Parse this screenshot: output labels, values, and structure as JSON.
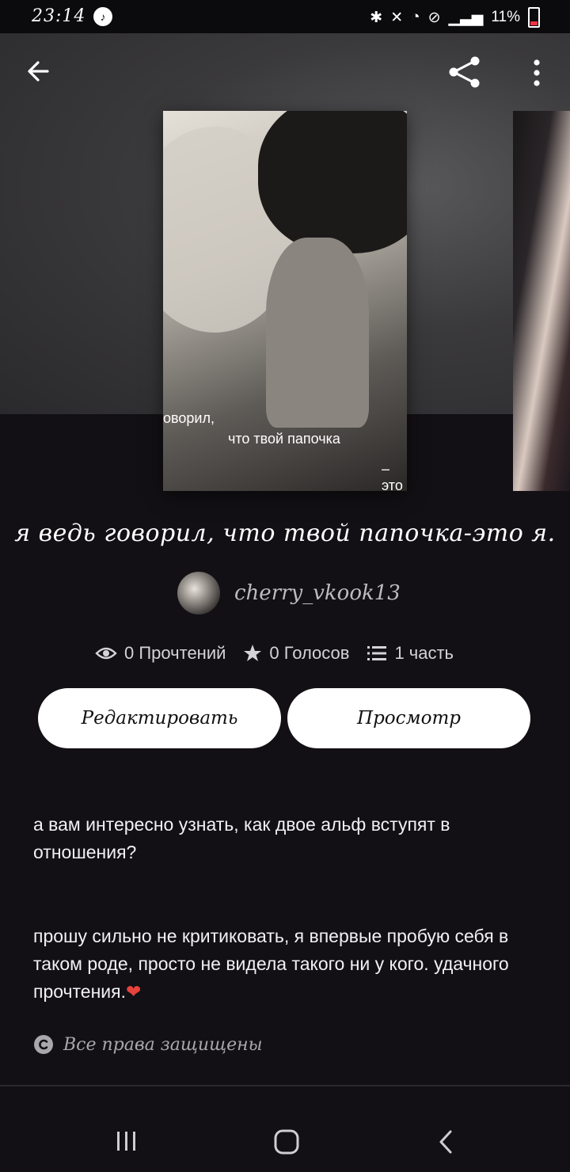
{
  "status_bar": {
    "time": "23:14",
    "battery": "11%"
  },
  "story": {
    "cover_overlay_lines": [
      "оворил,",
      "что твой папочка",
      "– это"
    ],
    "title": "я ведь говорил, что твой папочка-это я.",
    "author": "cherry_vkook13",
    "stats": {
      "reads": "0 Прочтений",
      "votes": "0 Голосов",
      "parts": "1 часть"
    },
    "buttons": {
      "edit": "Редактировать",
      "preview": "Просмотр"
    },
    "description": [
      "а вам интересно узнать, как двое альф вступят в отношения?",
      "прошу сильно не критиковать, я впервые пробую себя в таком роде, просто не видела такого ни у кого. удачного прочтения."
    ],
    "heart_glyph": "❤",
    "rights": "Все права защищены"
  },
  "colors": {
    "background": "#121014",
    "button_bg": "#ffffff",
    "heart": "#e8423c"
  },
  "icons": [
    "back-arrow-icon",
    "share-icon",
    "more-vert-icon",
    "eye-icon",
    "star-icon",
    "list-icon",
    "copyright-icon",
    "nav-recents-icon",
    "nav-home-icon",
    "nav-back-icon"
  ]
}
